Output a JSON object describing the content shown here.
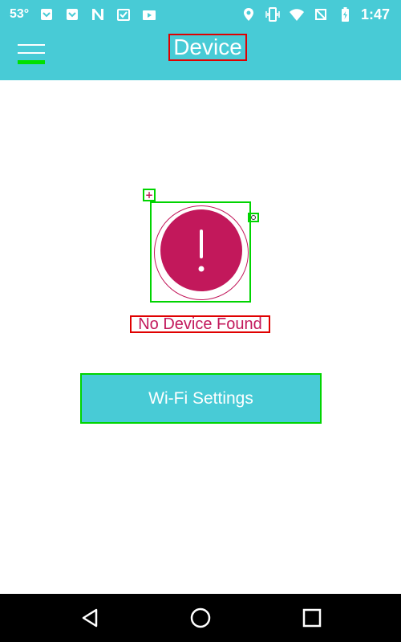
{
  "status_bar": {
    "temperature": "53°",
    "time": "1:47",
    "left_icons": [
      "notification-icon-1",
      "notification-icon-2",
      "n-icon",
      "clipboard-check-icon",
      "play-store-icon"
    ],
    "right_icons": [
      "location-icon",
      "vibrate-icon",
      "wifi-icon",
      "no-sim-icon",
      "battery-charging-icon"
    ]
  },
  "app_bar": {
    "title": "Device",
    "menu_icon": "hamburger-menu-icon"
  },
  "main": {
    "alert_icon": "exclamation-icon",
    "message": "No Device Found",
    "wifi_button_label": "Wi-Fi Settings"
  },
  "nav_bar": {
    "back_icon": "back-icon",
    "home_icon": "home-icon",
    "recents_icon": "recents-icon"
  },
  "colors": {
    "primary": "#48cbd6",
    "accent": "#c2185b",
    "nav": "#000000"
  }
}
